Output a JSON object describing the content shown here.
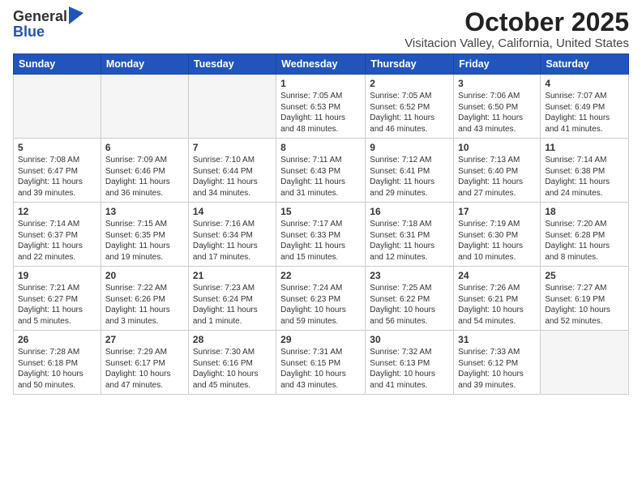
{
  "header": {
    "logo_general": "General",
    "logo_blue": "Blue",
    "month": "October 2025",
    "location": "Visitacion Valley, California, United States"
  },
  "weekdays": [
    "Sunday",
    "Monday",
    "Tuesday",
    "Wednesday",
    "Thursday",
    "Friday",
    "Saturday"
  ],
  "weeks": [
    [
      {
        "day": "",
        "info": ""
      },
      {
        "day": "",
        "info": ""
      },
      {
        "day": "",
        "info": ""
      },
      {
        "day": "1",
        "info": "Sunrise: 7:05 AM\nSunset: 6:53 PM\nDaylight: 11 hours\nand 48 minutes."
      },
      {
        "day": "2",
        "info": "Sunrise: 7:05 AM\nSunset: 6:52 PM\nDaylight: 11 hours\nand 46 minutes."
      },
      {
        "day": "3",
        "info": "Sunrise: 7:06 AM\nSunset: 6:50 PM\nDaylight: 11 hours\nand 43 minutes."
      },
      {
        "day": "4",
        "info": "Sunrise: 7:07 AM\nSunset: 6:49 PM\nDaylight: 11 hours\nand 41 minutes."
      }
    ],
    [
      {
        "day": "5",
        "info": "Sunrise: 7:08 AM\nSunset: 6:47 PM\nDaylight: 11 hours\nand 39 minutes."
      },
      {
        "day": "6",
        "info": "Sunrise: 7:09 AM\nSunset: 6:46 PM\nDaylight: 11 hours\nand 36 minutes."
      },
      {
        "day": "7",
        "info": "Sunrise: 7:10 AM\nSunset: 6:44 PM\nDaylight: 11 hours\nand 34 minutes."
      },
      {
        "day": "8",
        "info": "Sunrise: 7:11 AM\nSunset: 6:43 PM\nDaylight: 11 hours\nand 31 minutes."
      },
      {
        "day": "9",
        "info": "Sunrise: 7:12 AM\nSunset: 6:41 PM\nDaylight: 11 hours\nand 29 minutes."
      },
      {
        "day": "10",
        "info": "Sunrise: 7:13 AM\nSunset: 6:40 PM\nDaylight: 11 hours\nand 27 minutes."
      },
      {
        "day": "11",
        "info": "Sunrise: 7:14 AM\nSunset: 6:38 PM\nDaylight: 11 hours\nand 24 minutes."
      }
    ],
    [
      {
        "day": "12",
        "info": "Sunrise: 7:14 AM\nSunset: 6:37 PM\nDaylight: 11 hours\nand 22 minutes."
      },
      {
        "day": "13",
        "info": "Sunrise: 7:15 AM\nSunset: 6:35 PM\nDaylight: 11 hours\nand 19 minutes."
      },
      {
        "day": "14",
        "info": "Sunrise: 7:16 AM\nSunset: 6:34 PM\nDaylight: 11 hours\nand 17 minutes."
      },
      {
        "day": "15",
        "info": "Sunrise: 7:17 AM\nSunset: 6:33 PM\nDaylight: 11 hours\nand 15 minutes."
      },
      {
        "day": "16",
        "info": "Sunrise: 7:18 AM\nSunset: 6:31 PM\nDaylight: 11 hours\nand 12 minutes."
      },
      {
        "day": "17",
        "info": "Sunrise: 7:19 AM\nSunset: 6:30 PM\nDaylight: 11 hours\nand 10 minutes."
      },
      {
        "day": "18",
        "info": "Sunrise: 7:20 AM\nSunset: 6:28 PM\nDaylight: 11 hours\nand 8 minutes."
      }
    ],
    [
      {
        "day": "19",
        "info": "Sunrise: 7:21 AM\nSunset: 6:27 PM\nDaylight: 11 hours\nand 5 minutes."
      },
      {
        "day": "20",
        "info": "Sunrise: 7:22 AM\nSunset: 6:26 PM\nDaylight: 11 hours\nand 3 minutes."
      },
      {
        "day": "21",
        "info": "Sunrise: 7:23 AM\nSunset: 6:24 PM\nDaylight: 11 hours\nand 1 minute."
      },
      {
        "day": "22",
        "info": "Sunrise: 7:24 AM\nSunset: 6:23 PM\nDaylight: 10 hours\nand 59 minutes."
      },
      {
        "day": "23",
        "info": "Sunrise: 7:25 AM\nSunset: 6:22 PM\nDaylight: 10 hours\nand 56 minutes."
      },
      {
        "day": "24",
        "info": "Sunrise: 7:26 AM\nSunset: 6:21 PM\nDaylight: 10 hours\nand 54 minutes."
      },
      {
        "day": "25",
        "info": "Sunrise: 7:27 AM\nSunset: 6:19 PM\nDaylight: 10 hours\nand 52 minutes."
      }
    ],
    [
      {
        "day": "26",
        "info": "Sunrise: 7:28 AM\nSunset: 6:18 PM\nDaylight: 10 hours\nand 50 minutes."
      },
      {
        "day": "27",
        "info": "Sunrise: 7:29 AM\nSunset: 6:17 PM\nDaylight: 10 hours\nand 47 minutes."
      },
      {
        "day": "28",
        "info": "Sunrise: 7:30 AM\nSunset: 6:16 PM\nDaylight: 10 hours\nand 45 minutes."
      },
      {
        "day": "29",
        "info": "Sunrise: 7:31 AM\nSunset: 6:15 PM\nDaylight: 10 hours\nand 43 minutes."
      },
      {
        "day": "30",
        "info": "Sunrise: 7:32 AM\nSunset: 6:13 PM\nDaylight: 10 hours\nand 41 minutes."
      },
      {
        "day": "31",
        "info": "Sunrise: 7:33 AM\nSunset: 6:12 PM\nDaylight: 10 hours\nand 39 minutes."
      },
      {
        "day": "",
        "info": ""
      }
    ]
  ]
}
